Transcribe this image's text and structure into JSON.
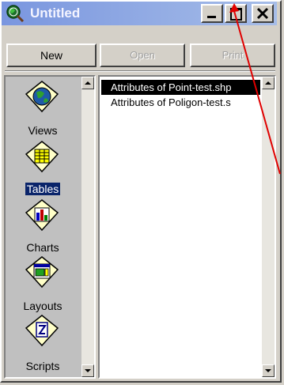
{
  "window": {
    "title": "Untitled"
  },
  "toolbar": {
    "new_label": "New",
    "open_label": "Open",
    "print_label": "Print"
  },
  "project_items": [
    {
      "label": "Views",
      "icon": "views-globe-icon",
      "selected": false
    },
    {
      "label": "Tables",
      "icon": "tables-grid-icon",
      "selected": true
    },
    {
      "label": "Charts",
      "icon": "charts-bar-icon",
      "selected": false
    },
    {
      "label": "Layouts",
      "icon": "layouts-page-icon",
      "selected": false
    },
    {
      "label": "Scripts",
      "icon": "scripts-doc-icon",
      "selected": false
    }
  ],
  "documents": [
    {
      "label": "Attributes of Point-test.shp",
      "selected": true
    },
    {
      "label": "Attributes of Poligon-test.s",
      "selected": false
    }
  ],
  "colors": {
    "titlebar_start": "#7a96df",
    "titlebar_end": "#a6bde8",
    "selection": "#0a246a",
    "annotation_arrow": "#e00000"
  }
}
